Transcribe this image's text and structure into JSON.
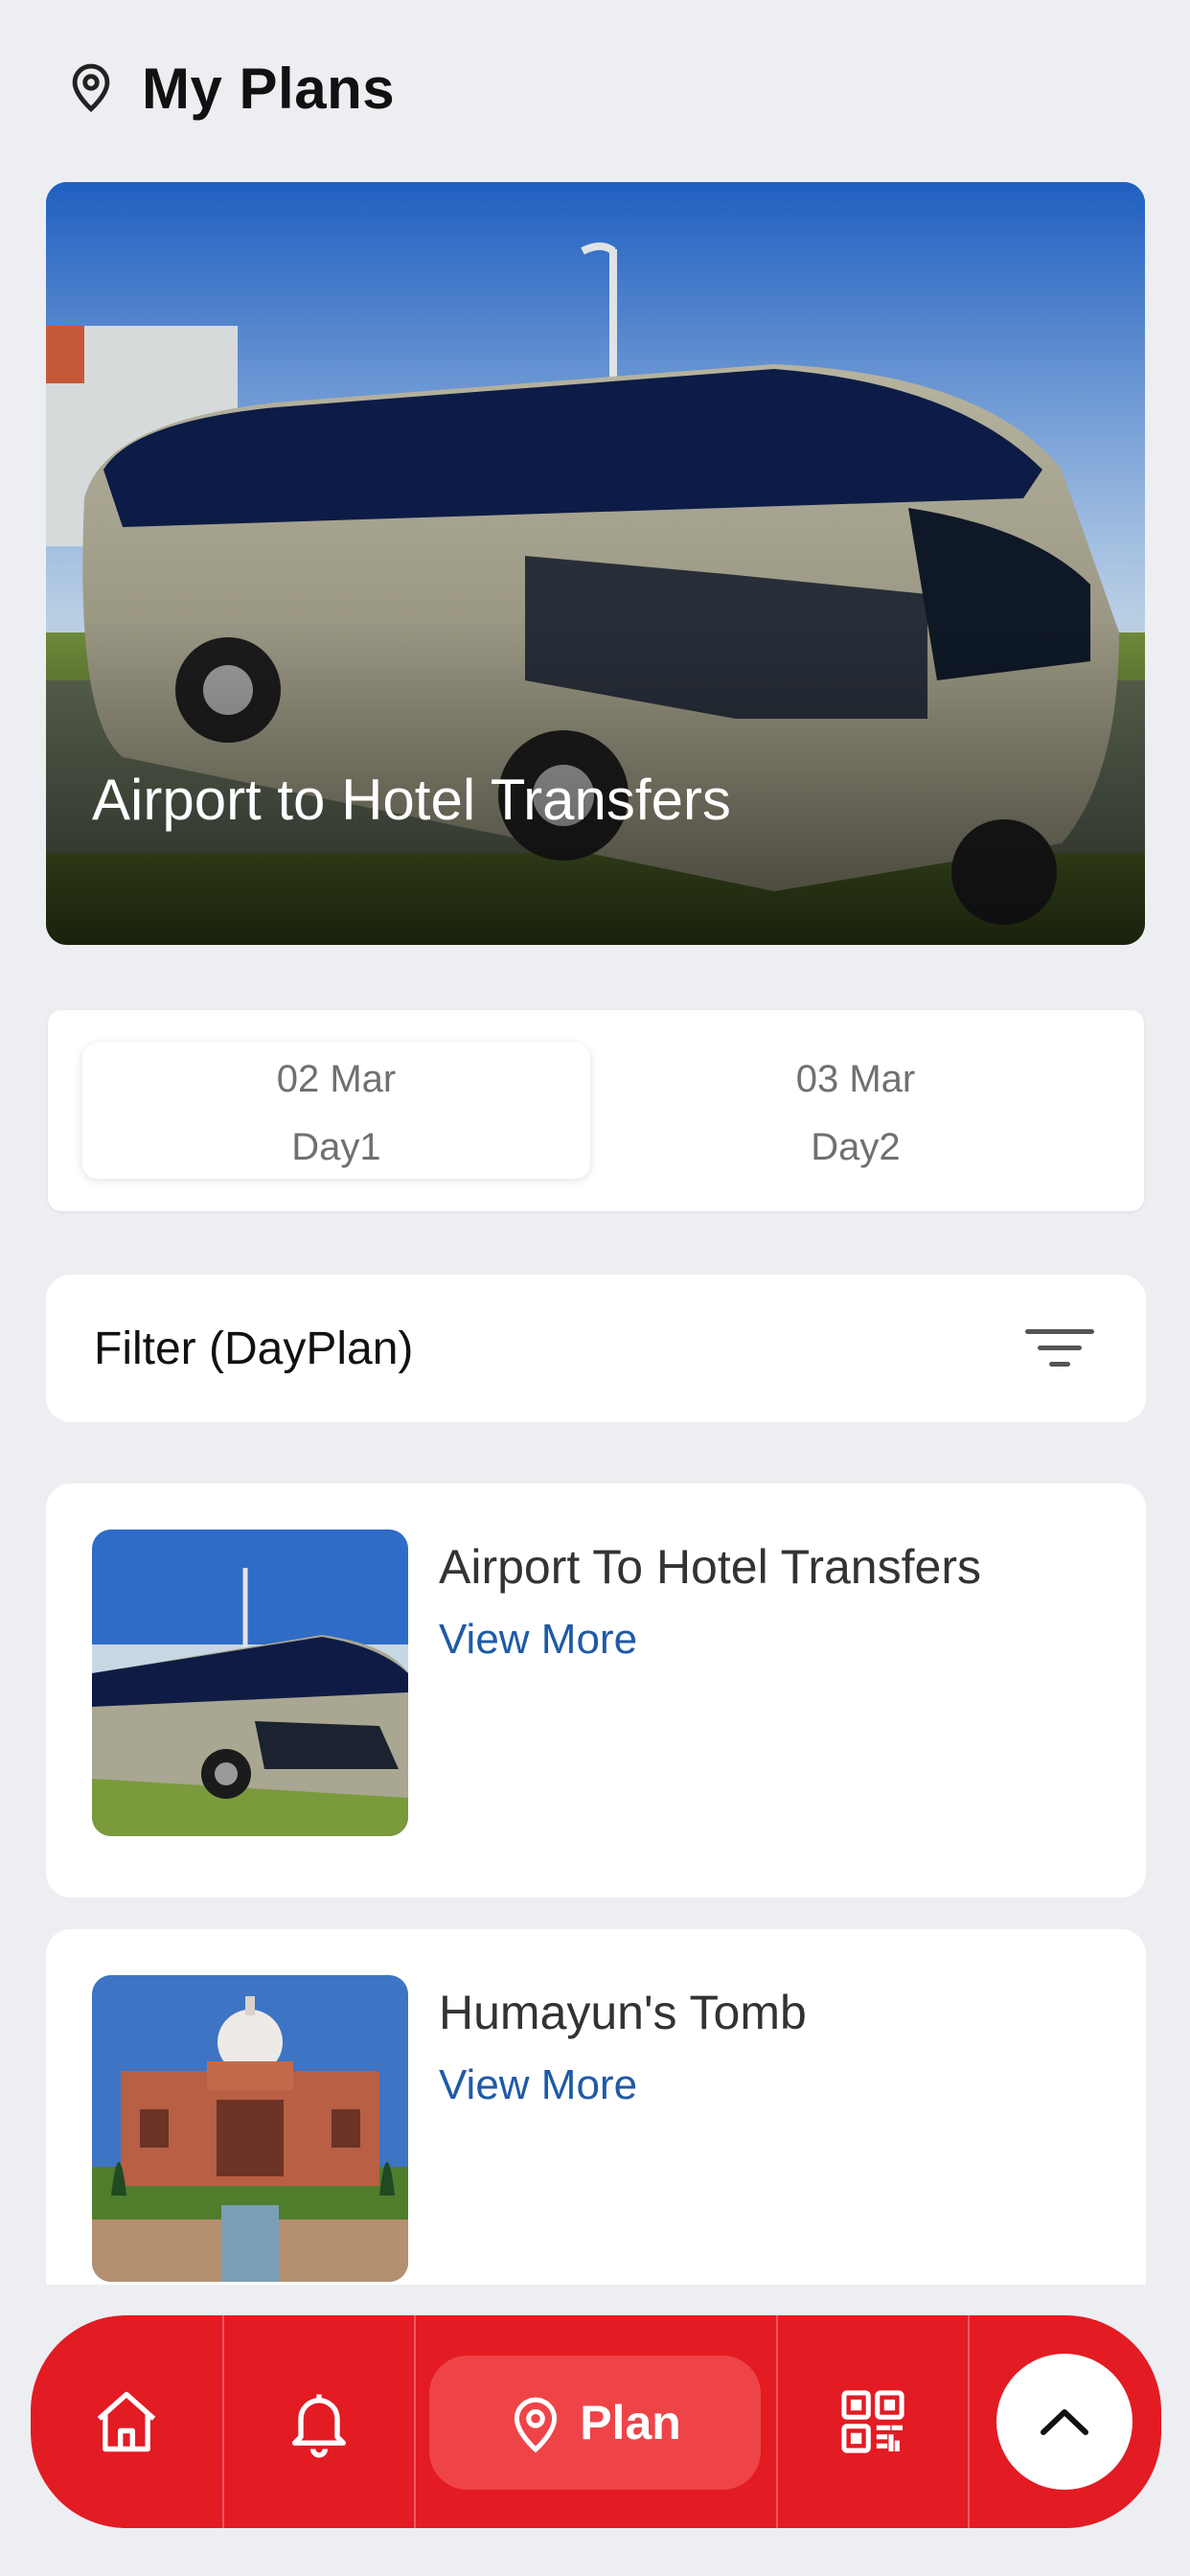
{
  "header": {
    "title": "My Plans",
    "icon": "location-pin-icon"
  },
  "hero": {
    "title": "Airport to Hotel Transfers"
  },
  "days": [
    {
      "date": "02 Mar",
      "label": "Day1",
      "active": true
    },
    {
      "date": "03 Mar",
      "label": "Day2",
      "active": false
    }
  ],
  "filter": {
    "label": "Filter (DayPlan)",
    "icon": "filter-icon"
  },
  "plans": [
    {
      "title": "Airport To Hotel Transfers",
      "link": "View More",
      "image": "bus"
    },
    {
      "title": "Humayun's Tomb",
      "link": "View More",
      "image": "tomb"
    }
  ],
  "nav": {
    "items": [
      {
        "name": "home",
        "icon": "home-icon"
      },
      {
        "name": "notifications",
        "icon": "bell-icon"
      },
      {
        "name": "plan",
        "icon": "location-pin-icon",
        "label": "Plan",
        "active": true
      },
      {
        "name": "qr",
        "icon": "qr-code-icon"
      }
    ],
    "scroll_up_icon": "chevron-up-icon"
  },
  "colors": {
    "brand_red": "#E31B23",
    "link_blue": "#1F5AA6",
    "background": "#EDEEF2"
  }
}
